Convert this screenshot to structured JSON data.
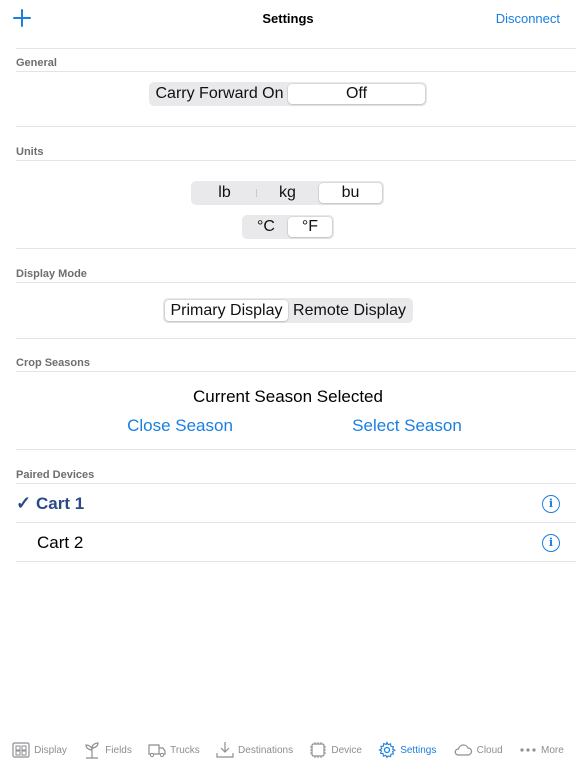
{
  "nav": {
    "title": "Settings",
    "right_label": "Disconnect"
  },
  "general": {
    "header": "General",
    "options": [
      "Carry Forward On",
      "Off"
    ],
    "selected": 1
  },
  "units": {
    "header": "Units",
    "weight_options": [
      "lb",
      "kg",
      "bu"
    ],
    "weight_selected": 2,
    "temp_options": [
      "°C",
      "°F"
    ],
    "temp_selected": 1
  },
  "display_mode": {
    "header": "Display Mode",
    "options": [
      "Primary Display",
      "Remote Display"
    ],
    "selected": 0
  },
  "crop_seasons": {
    "header": "Crop Seasons",
    "status": "Current Season Selected",
    "close_label": "Close Season",
    "select_label": "Select Season"
  },
  "paired_devices": {
    "header": "Paired Devices",
    "devices": [
      {
        "name": "Cart 1",
        "selected": true
      },
      {
        "name": "Cart 2",
        "selected": false
      }
    ]
  },
  "tabbar": {
    "tabs": [
      {
        "label": "Display",
        "icon": "display-icon"
      },
      {
        "label": "Fields",
        "icon": "sprout-icon"
      },
      {
        "label": "Trucks",
        "icon": "truck-icon"
      },
      {
        "label": "Destinations",
        "icon": "download-tray-icon"
      },
      {
        "label": "Device",
        "icon": "device-chip-icon"
      },
      {
        "label": "Settings",
        "icon": "gear-icon",
        "active": true
      },
      {
        "label": "Cloud",
        "icon": "cloud-icon"
      },
      {
        "label": "More",
        "icon": "more-dots-icon"
      }
    ]
  },
  "colors": {
    "accent": "#1a7fe0",
    "selected_text": "#2a4a8a",
    "header_text": "#6d6d72"
  }
}
